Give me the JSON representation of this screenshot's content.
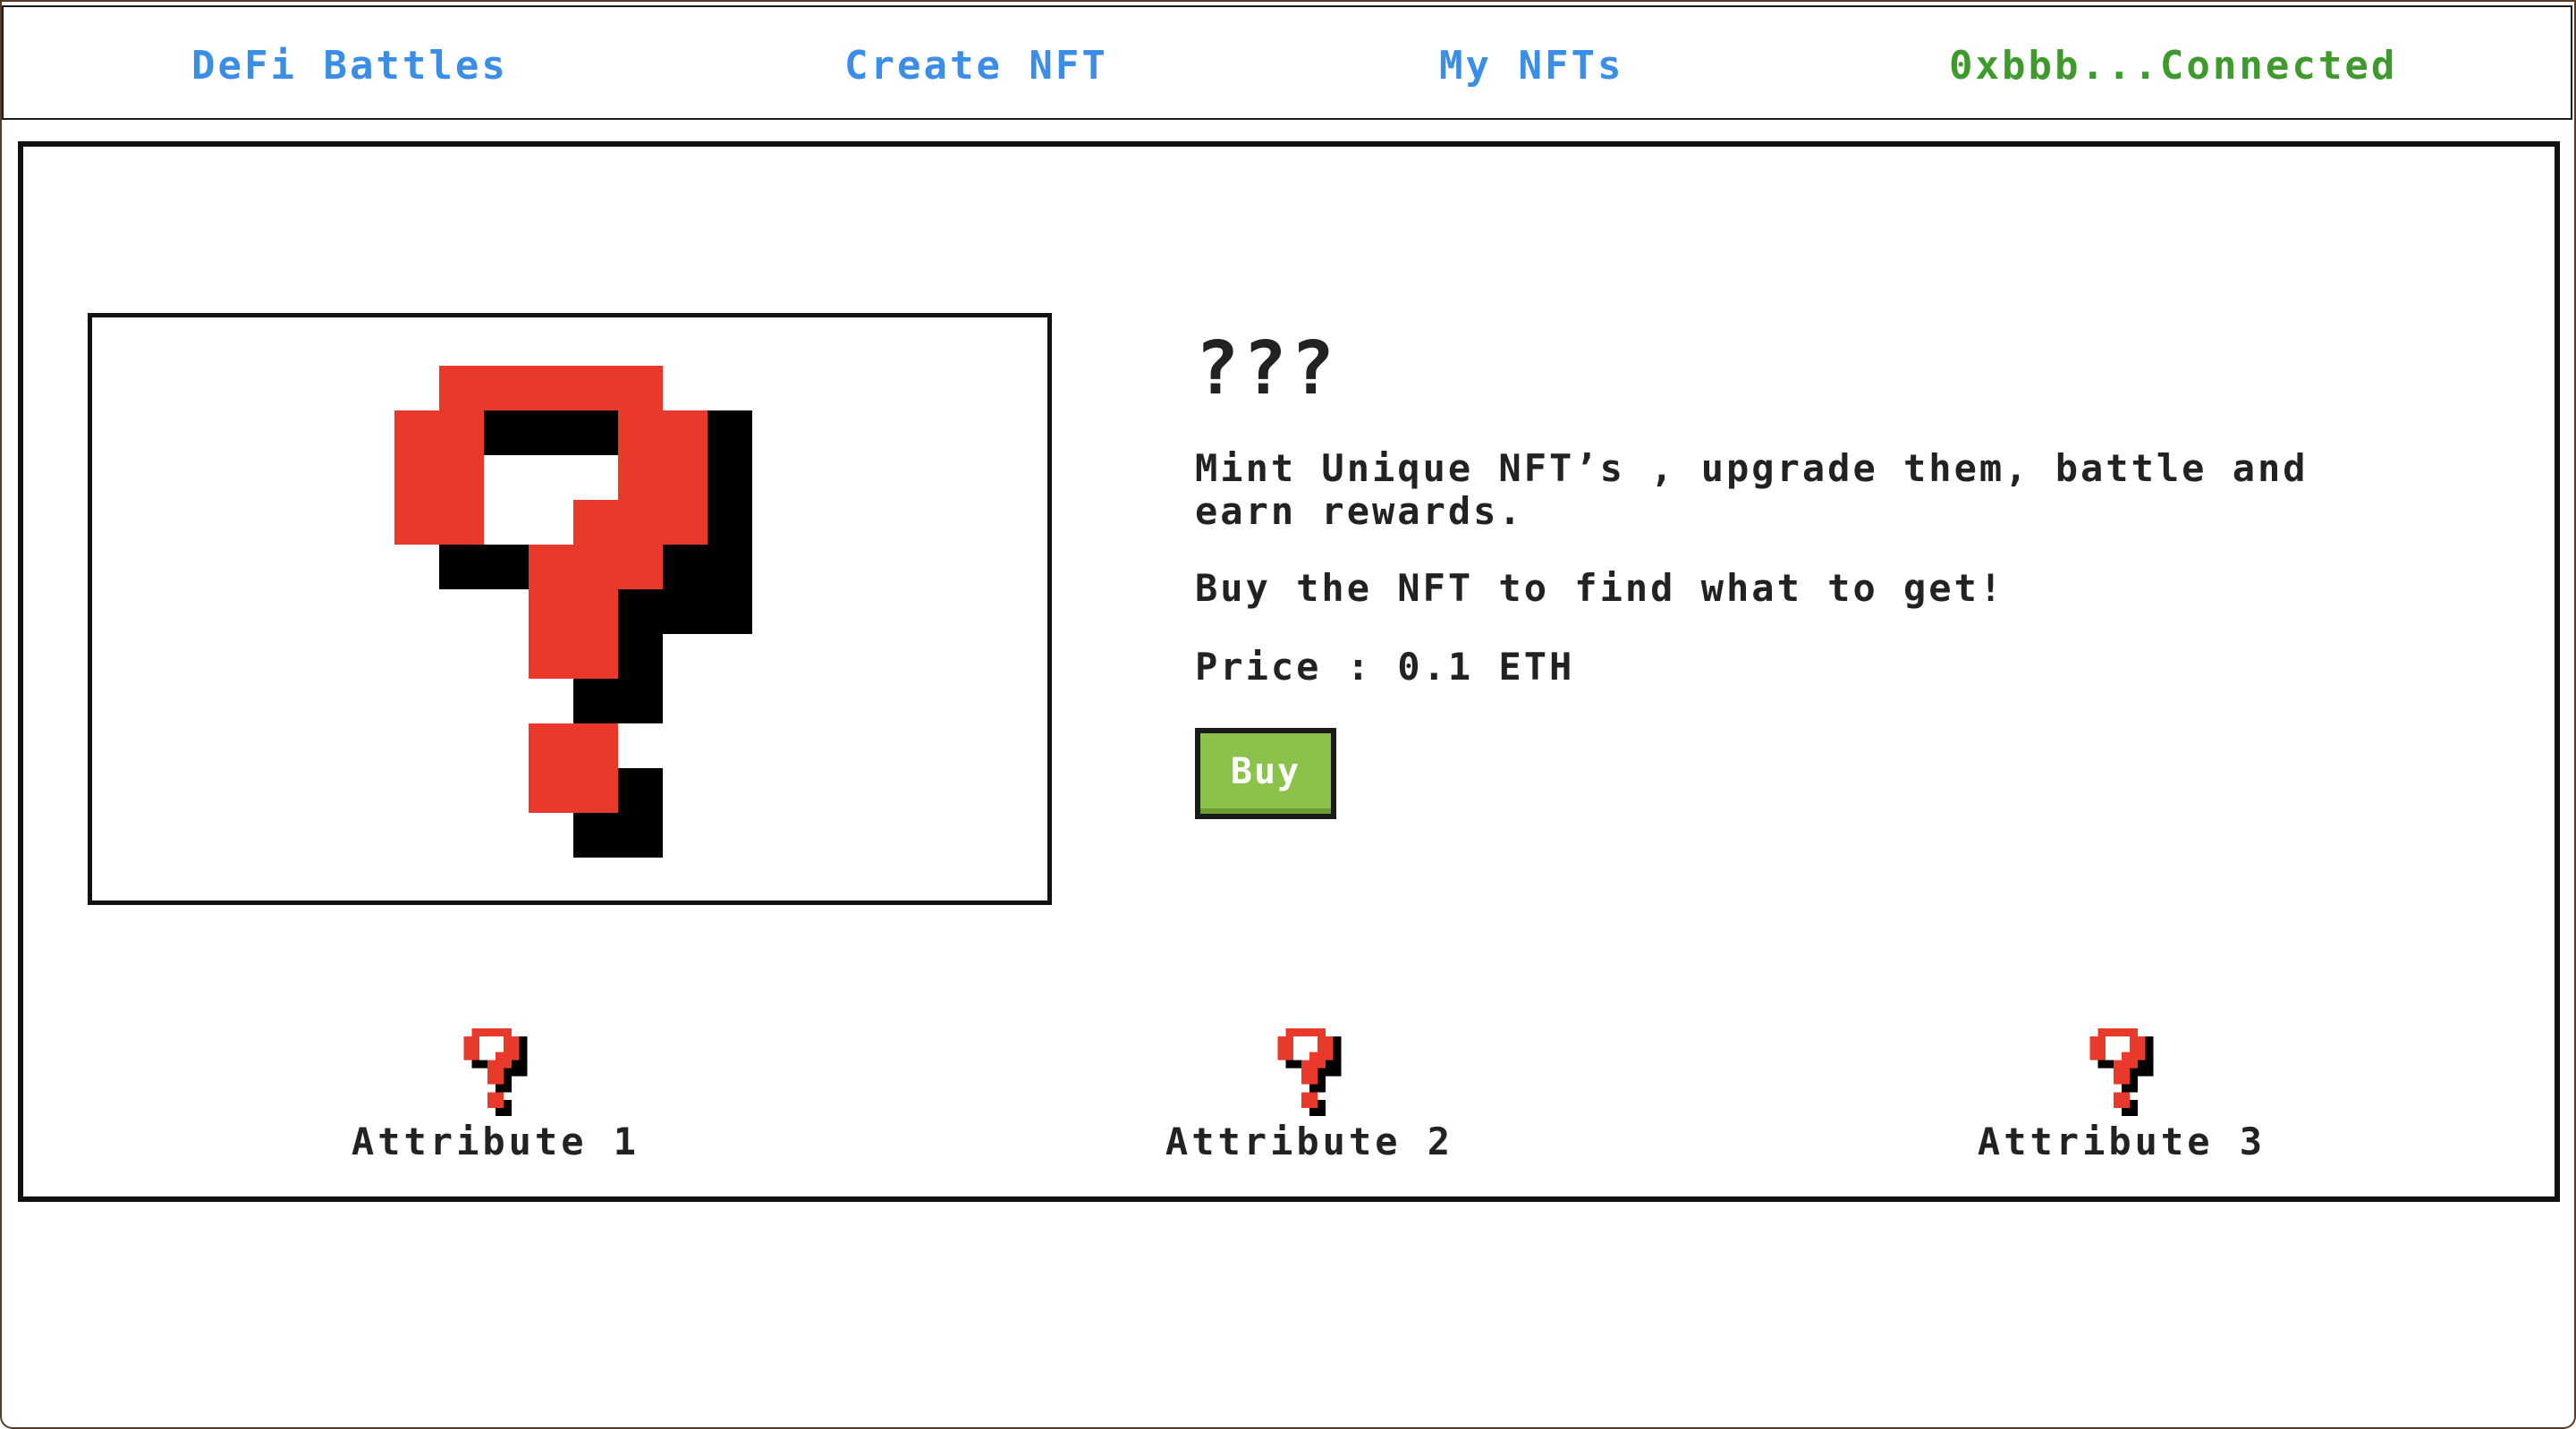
{
  "nav": {
    "brand": "DeFi Battles",
    "create": "Create NFT",
    "mine": "My NFTs",
    "wallet": "0xbbb...Connected"
  },
  "nft": {
    "name": "???",
    "description": "Mint Unique NFT’s , upgrade them, battle and earn rewards.",
    "hint": "Buy the NFT to find what to get!",
    "price": "Price : 0.1 ETH",
    "buy_label": "Buy",
    "image_icon": "question-mark-icon"
  },
  "attributes": [
    {
      "label": "Attribute 1",
      "icon": "question-mark-icon"
    },
    {
      "label": "Attribute 2",
      "icon": "question-mark-icon"
    },
    {
      "label": "Attribute 3",
      "icon": "question-mark-icon"
    }
  ],
  "colors": {
    "nav_link": "#3a8ee6",
    "wallet_connected": "#3f9a2e",
    "question_red": "#e8392a",
    "question_shadow": "#000000",
    "buy_button": "#8bc34a"
  }
}
